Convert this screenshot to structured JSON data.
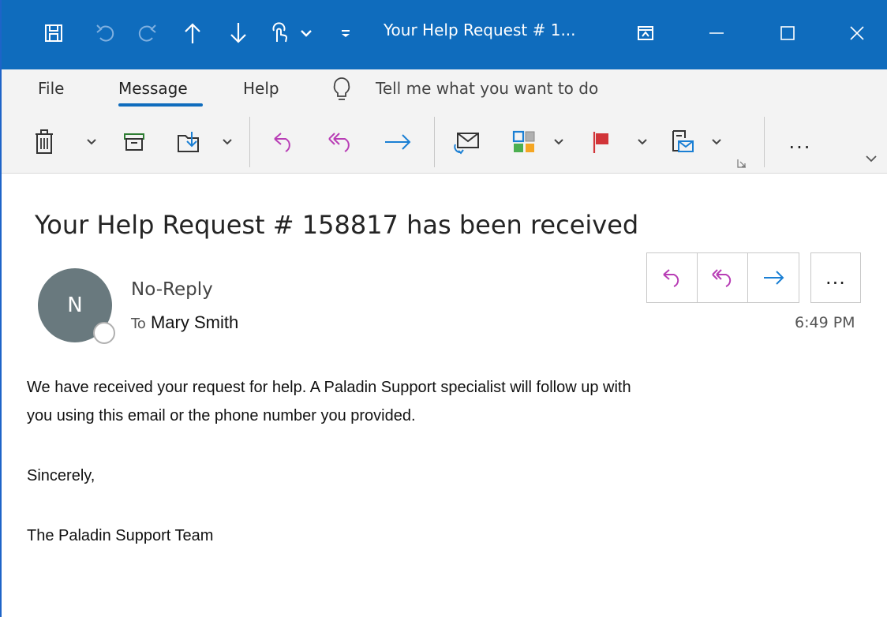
{
  "window": {
    "title": "Your Help Request # 1..."
  },
  "menu": {
    "file": "File",
    "message": "Message",
    "help": "Help",
    "tell_me": "Tell me what you want to do"
  },
  "email": {
    "subject": "Your Help Request # 158817 has been received",
    "avatar_initial": "N",
    "sender": "No-Reply",
    "to_label": "To",
    "recipient": "Mary Smith",
    "time": "6:49 PM",
    "more_label": "...",
    "body": [
      "We have received your request for help. A Paladin Support specialist will follow up with",
      "you using this email or the phone number you provided.",
      "Sincerely,",
      "The Paladin Support Team"
    ]
  },
  "ribbon": {
    "more_label": "..."
  },
  "colors": {
    "accent": "#0f6cbd",
    "reply": "#b83db5",
    "forward": "#1a7fd4",
    "flag": "#d13438"
  }
}
